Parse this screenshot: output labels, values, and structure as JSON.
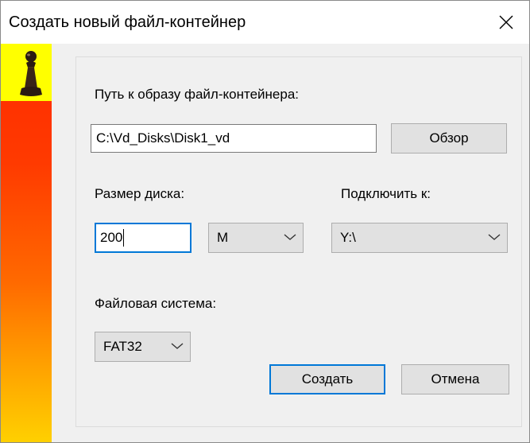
{
  "window": {
    "title": "Создать новый файл-контейнер",
    "close_icon": "close-icon"
  },
  "banner": {
    "icon": "pawn-icon",
    "colors": {
      "top": "#ffff00",
      "gradient_start": "#ff2a00",
      "gradient_end": "#ffd000"
    }
  },
  "form": {
    "path_label": "Путь к образу файл-контейнера:",
    "path_value": "C:\\Vd_Disks\\Disk1_vd",
    "browse_label": "Обзор",
    "disk_size_label": "Размер диска:",
    "disk_size_value": "200",
    "unit_value": "M",
    "mount_label": "Подключить к:",
    "mount_value": "Y:\\",
    "fs_label": "Файловая система:",
    "fs_value": "FAT32",
    "create_label": "Создать",
    "cancel_label": "Отмена"
  },
  "colors": {
    "accent": "#0078d7",
    "dialog_bg": "#f0f0f0",
    "button_bg": "#e1e1e1"
  }
}
